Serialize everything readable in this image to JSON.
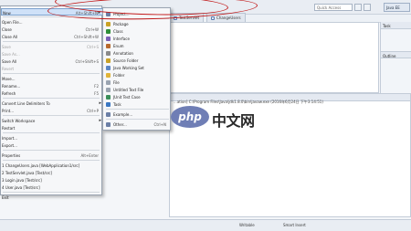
{
  "editor_tabs": [
    "TestServlet",
    "ChangeUsers"
  ],
  "quick_access": {
    "placeholder": "Quick Access"
  },
  "perspective": {
    "label": "Java EE"
  },
  "side_panel": {
    "title": "Task",
    "section": "Outline"
  },
  "console": {
    "line": "...ation] C:\\Program Files\\Java\\jdk1.8.0\\bin\\javaw.exe (2016年6月24日 下午3:14:51)"
  },
  "status_bar": {
    "writable": "Writable",
    "mode": "Smart Insert"
  },
  "file_menu": {
    "items": [
      {
        "label": "New",
        "shortcut": "Alt+Shift+N",
        "arrow": "▸",
        "highlighted": true,
        "disabled": false
      },
      {
        "label": "Open File...",
        "shortcut": "",
        "arrow": "",
        "highlighted": false,
        "disabled": false
      },
      {
        "label": "Close",
        "shortcut": "Ctrl+W",
        "arrow": "",
        "highlighted": false,
        "disabled": false
      },
      {
        "label": "Close All",
        "shortcut": "Ctrl+Shift+W",
        "arrow": "",
        "highlighted": false,
        "disabled": false
      },
      {
        "label": "Save",
        "shortcut": "Ctrl+S",
        "arrow": "",
        "highlighted": false,
        "disabled": true
      },
      {
        "label": "Save As...",
        "shortcut": "",
        "arrow": "",
        "highlighted": false,
        "disabled": true
      },
      {
        "label": "Save All",
        "shortcut": "Ctrl+Shift+S",
        "arrow": "",
        "highlighted": false,
        "disabled": false
      },
      {
        "label": "Revert",
        "shortcut": "",
        "arrow": "",
        "highlighted": false,
        "disabled": true
      },
      {
        "label": "Move...",
        "shortcut": "",
        "arrow": "",
        "highlighted": false,
        "disabled": false
      },
      {
        "label": "Rename...",
        "shortcut": "F2",
        "arrow": "",
        "highlighted": false,
        "disabled": false
      },
      {
        "label": "Refresh",
        "shortcut": "F5",
        "arrow": "",
        "highlighted": false,
        "disabled": false
      },
      {
        "label": "Convert Line Delimiters To",
        "shortcut": "",
        "arrow": "▸",
        "highlighted": false,
        "disabled": false
      },
      {
        "label": "Print...",
        "shortcut": "Ctrl+P",
        "arrow": "",
        "highlighted": false,
        "disabled": false
      },
      {
        "label": "Switch Workspace",
        "shortcut": "",
        "arrow": "▸",
        "highlighted": false,
        "disabled": false
      },
      {
        "label": "Restart",
        "shortcut": "",
        "arrow": "",
        "highlighted": false,
        "disabled": false
      },
      {
        "label": "Import...",
        "shortcut": "",
        "arrow": "",
        "highlighted": false,
        "disabled": false
      },
      {
        "label": "Export...",
        "shortcut": "",
        "arrow": "",
        "highlighted": false,
        "disabled": false
      },
      {
        "label": "Properties",
        "shortcut": "Alt+Enter",
        "arrow": "",
        "highlighted": false,
        "disabled": false
      },
      {
        "label": "1 ChangeUsers.java [WebApplication1/src]",
        "shortcut": "",
        "arrow": "",
        "highlighted": false,
        "disabled": false
      },
      {
        "label": "2 TestServlet.java [Test/src]",
        "shortcut": "",
        "arrow": "",
        "highlighted": false,
        "disabled": false
      },
      {
        "label": "3 Login.java [Test/src]",
        "shortcut": "",
        "arrow": "",
        "highlighted": false,
        "disabled": false
      },
      {
        "label": "4 User.java [Test/src]",
        "shortcut": "",
        "arrow": "",
        "highlighted": false,
        "disabled": false
      },
      {
        "label": "Exit",
        "shortcut": "",
        "arrow": "",
        "highlighted": false,
        "disabled": false
      }
    ]
  },
  "new_submenu": {
    "items": [
      {
        "label": "Project...",
        "shortcut": "",
        "icon_color": "#6b7fa6"
      },
      {
        "label": "Package",
        "shortcut": "",
        "icon_color": "#c9a227"
      },
      {
        "label": "Class",
        "shortcut": "",
        "icon_color": "#2f8f3a"
      },
      {
        "label": "Interface",
        "shortcut": "",
        "icon_color": "#7b5fb8"
      },
      {
        "label": "Enum",
        "shortcut": "",
        "icon_color": "#b86a2f"
      },
      {
        "label": "Annotation",
        "shortcut": "",
        "icon_color": "#8a8a8a"
      },
      {
        "label": "Source Folder",
        "shortcut": "",
        "icon_color": "#c9a227"
      },
      {
        "label": "Java Working Set",
        "shortcut": "",
        "icon_color": "#5c86c4"
      },
      {
        "label": "Folder",
        "shortcut": "",
        "icon_color": "#e0b43a"
      },
      {
        "label": "File",
        "shortcut": "",
        "icon_color": "#9aa4b1"
      },
      {
        "label": "Untitled Text File",
        "shortcut": "",
        "icon_color": "#9aa4b1"
      },
      {
        "label": "JUnit Test Case",
        "shortcut": "",
        "icon_color": "#3b8f5b"
      },
      {
        "label": "Task",
        "shortcut": "",
        "icon_color": "#3a77c2"
      },
      {
        "label": "Example...",
        "shortcut": "",
        "icon_color": "#6b7fa6"
      },
      {
        "label": "Other...",
        "shortcut": "Ctrl+N",
        "icon_color": "#6b7fa6"
      }
    ]
  },
  "watermark": {
    "text": "php 中文网",
    "logo_text": "php",
    "caption": "中文网"
  },
  "colors": {
    "accent": "#cfe1f8",
    "annotation": "#c21a1a",
    "logo": "#6f7eb5"
  }
}
